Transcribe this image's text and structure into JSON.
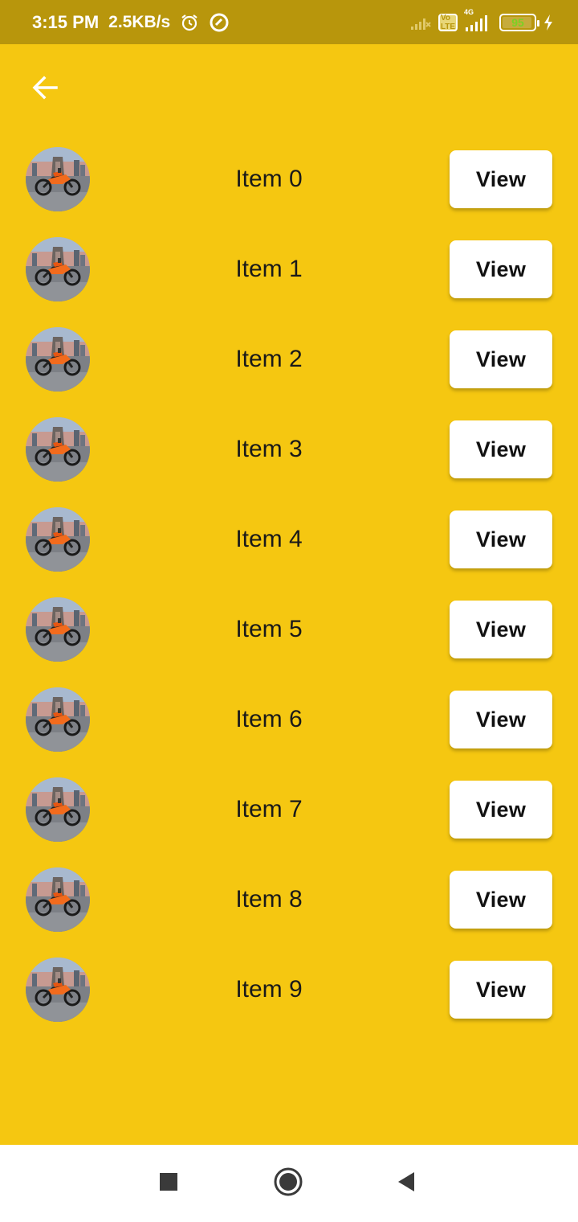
{
  "status_bar": {
    "time": "3:15 PM",
    "network_speed": "2.5KB/s",
    "volte": "Vo LTE",
    "network_type": "4G",
    "battery_level": "95"
  },
  "app_bar": {
    "back_icon": "arrow-back-icon"
  },
  "list": {
    "items": [
      {
        "title": "Item 0",
        "button_label": "View"
      },
      {
        "title": "Item 1",
        "button_label": "View"
      },
      {
        "title": "Item 2",
        "button_label": "View"
      },
      {
        "title": "Item 3",
        "button_label": "View"
      },
      {
        "title": "Item 4",
        "button_label": "View"
      },
      {
        "title": "Item 5",
        "button_label": "View"
      },
      {
        "title": "Item 6",
        "button_label": "View"
      },
      {
        "title": "Item 7",
        "button_label": "View"
      },
      {
        "title": "Item 8",
        "button_label": "View"
      },
      {
        "title": "Item 9",
        "button_label": "View"
      }
    ]
  },
  "nav_bar": {
    "recents_icon": "square-icon",
    "home_icon": "circle-icon",
    "back_icon": "triangle-back-icon"
  },
  "colors": {
    "background": "#f5c711",
    "status_bar": "#b8960c",
    "button_bg": "#ffffff",
    "text": "#1a1a1a"
  }
}
